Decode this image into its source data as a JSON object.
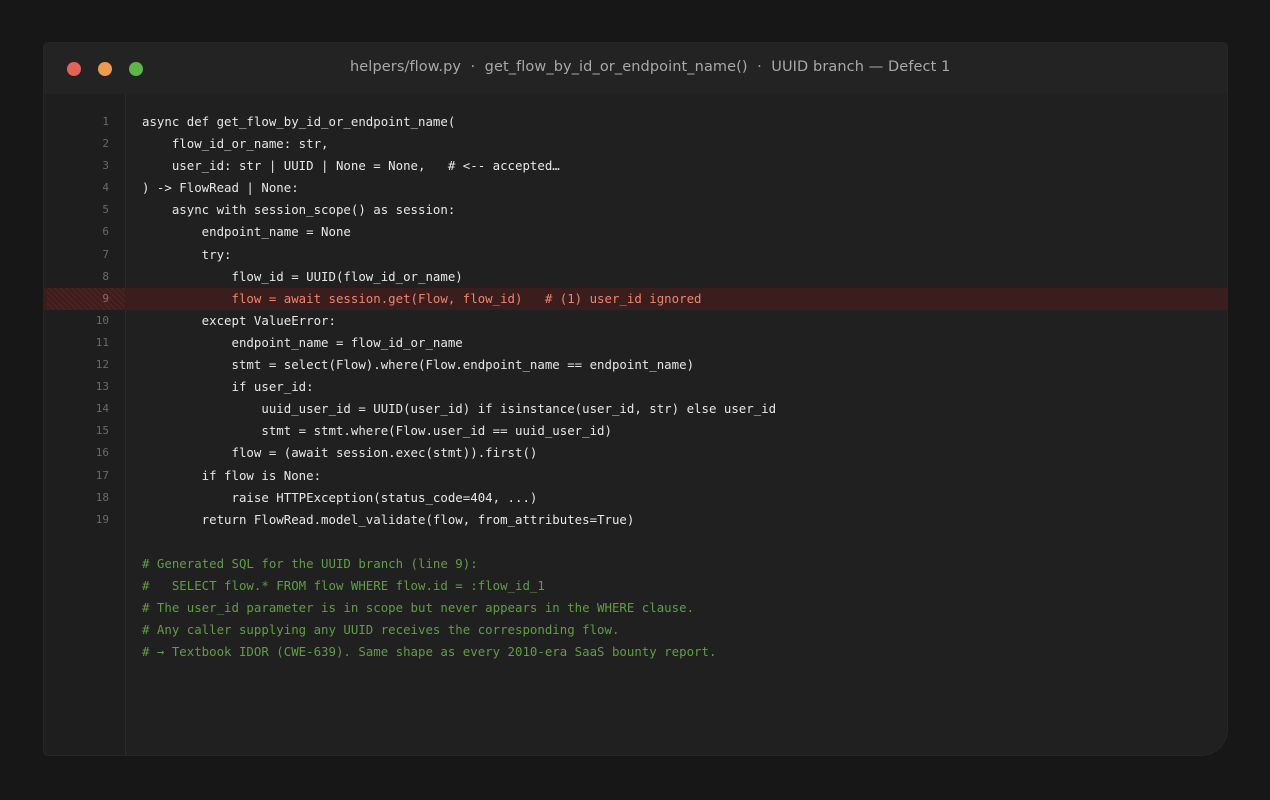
{
  "window": {
    "title": "helpers/flow.py  ·  get_flow_by_id_or_endpoint_name()  ·  UUID branch — Defect 1"
  },
  "colors": {
    "background": "#171717",
    "editor": "#202020",
    "code_text": "#e6e6e6",
    "highlight_text": "#f0846c",
    "highlight_bg": "#3a1e1e",
    "comment": "#5f9e45",
    "close_dot": "#e0645a",
    "minimize_dot": "#eb9a4f",
    "maximize_dot": "#5cb64a"
  },
  "code": {
    "lines": [
      {
        "num": "1",
        "text": "async def get_flow_by_id_or_endpoint_name("
      },
      {
        "num": "2",
        "text": "    flow_id_or_name: str,"
      },
      {
        "num": "3",
        "text": "    user_id: str | UUID | None = None,   # <-- accepted…"
      },
      {
        "num": "4",
        "text": ") -> FlowRead | None:"
      },
      {
        "num": "5",
        "text": "    async with session_scope() as session:"
      },
      {
        "num": "6",
        "text": "        endpoint_name = None"
      },
      {
        "num": "7",
        "text": "        try:"
      },
      {
        "num": "8",
        "text": "            flow_id = UUID(flow_id_or_name)"
      },
      {
        "num": "9",
        "text": "            flow = await session.get(Flow, flow_id)   # (1) user_id ignored",
        "highlight": true
      },
      {
        "num": "10",
        "text": "        except ValueError:"
      },
      {
        "num": "11",
        "text": "            endpoint_name = flow_id_or_name"
      },
      {
        "num": "12",
        "text": "            stmt = select(Flow).where(Flow.endpoint_name == endpoint_name)"
      },
      {
        "num": "13",
        "text": "            if user_id:"
      },
      {
        "num": "14",
        "text": "                uuid_user_id = UUID(user_id) if isinstance(user_id, str) else user_id"
      },
      {
        "num": "15",
        "text": "                stmt = stmt.where(Flow.user_id == uuid_user_id)"
      },
      {
        "num": "16",
        "text": "            flow = (await session.exec(stmt)).first()"
      },
      {
        "num": "17",
        "text": "        if flow is None:"
      },
      {
        "num": "18",
        "text": "            raise HTTPException(status_code=404, ...)"
      },
      {
        "num": "19",
        "text": "        return FlowRead.model_validate(flow, from_attributes=True)"
      }
    ],
    "comments": [
      "# Generated SQL for the UUID branch (line 9):",
      "#   SELECT flow.* FROM flow WHERE flow.id = :flow_id_1",
      "# The user_id parameter is in scope but never appears in the WHERE clause.",
      "# Any caller supplying any UUID receives the corresponding flow.",
      "# → Textbook IDOR (CWE-639). Same shape as every 2010-era SaaS bounty report."
    ]
  }
}
